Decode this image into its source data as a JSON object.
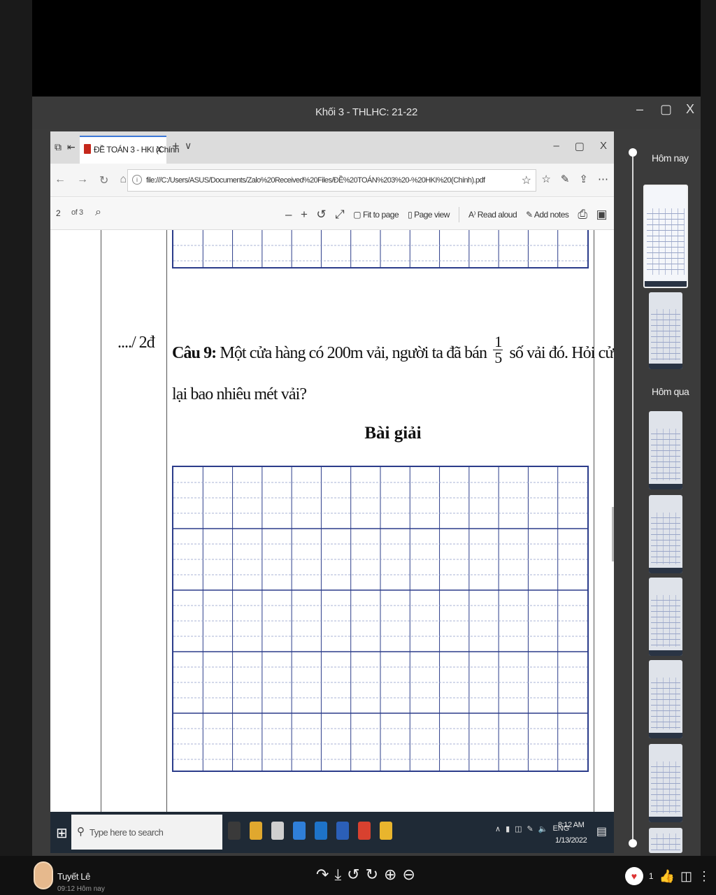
{
  "window": {
    "title": "Khối 3 - THLHC: 21-22",
    "controls": [
      "–",
      "▢",
      "X"
    ]
  },
  "browser": {
    "tab_label": "ĐỀ TOÁN 3 - HKI (Chính",
    "tab_close": "X",
    "new_tab": "+",
    "tab_menu": "∨",
    "url": "file:///C:/Users/ASUS/Documents/Zalo%20Received%20Files/ĐỀ%20TOÁN%203%20-%20HKI%20(Chính).pdf",
    "window_controls": [
      "–",
      "▢",
      "X"
    ]
  },
  "pdf_toolbar": {
    "page": "2",
    "of_pages": "of 3",
    "zoom_out": "–",
    "zoom_in": "+",
    "fit_to_page": "Fit to page",
    "page_view": "Page view",
    "read_aloud": "Read aloud",
    "add_notes": "Add notes"
  },
  "document": {
    "score": "..../ 2đ",
    "question_label": "Câu 9:",
    "question_text_a": "Một cửa hàng có 200m vải, người ta đã bán",
    "fraction_num": "1",
    "fraction_den": "5",
    "question_text_b": "số vải đó. Hỏi cửa hàng còn",
    "question_line2": "lại bao nhiêu mét vải?",
    "solution_title": "Bài giải"
  },
  "taskbar": {
    "search_placeholder": "Type here to search",
    "language": "ENG",
    "time": "8:12 AM",
    "date": "1/13/2022",
    "app_colors": [
      "#3a3a3a",
      "#e0a82e",
      "#cfcfcf",
      "#2f7fd9",
      "#1e73c8",
      "#2b5fb8",
      "#d8412f",
      "#e9b52d"
    ]
  },
  "panel": {
    "today_label": "Hôm nay",
    "yesterday_label": "Hôm qua"
  },
  "footer": {
    "user_name": "Tuyết Lê",
    "user_sub": "09:12 Hôm nay",
    "reaction_count": "1"
  }
}
